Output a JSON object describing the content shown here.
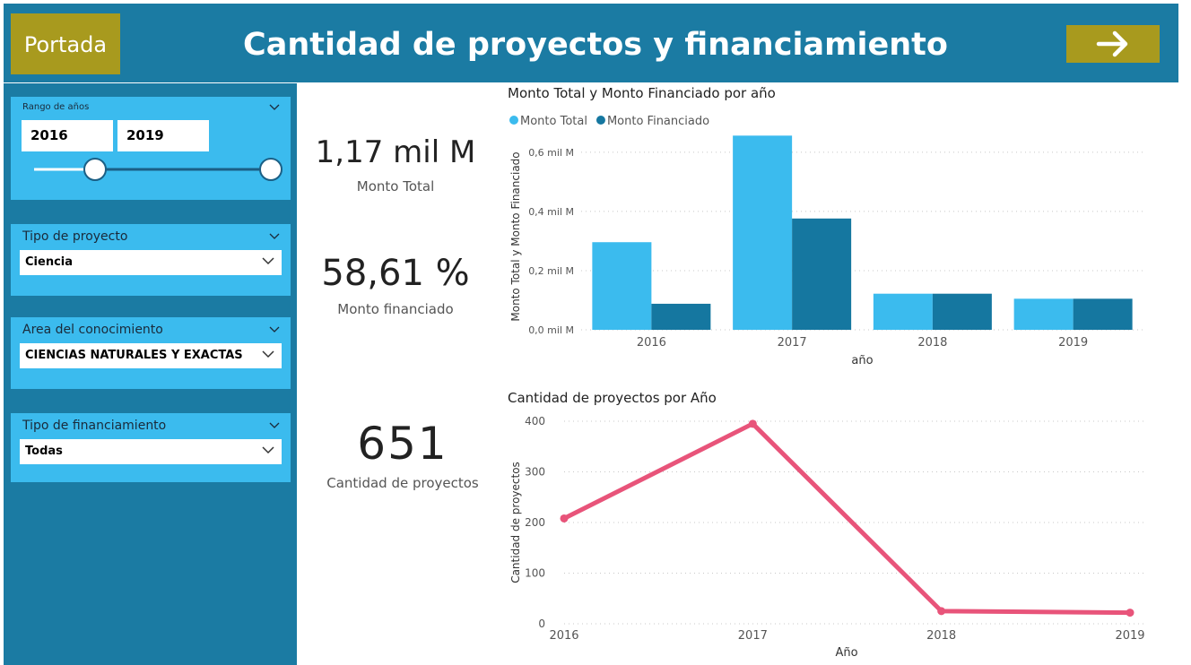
{
  "header": {
    "portada_label": "Portada",
    "title": "Cantidad de proyectos y financiamiento",
    "next_icon": "arrow-right-icon"
  },
  "filters": {
    "year_range": {
      "title": "Rango de años",
      "from": "2016",
      "to": "2019"
    },
    "tipo_proyecto": {
      "title": "Tipo de proyecto",
      "value": "Ciencia"
    },
    "area_conocimiento": {
      "title": "Area del conocimiento",
      "value": "CIENCIAS NATURALES Y EXACTAS"
    },
    "tipo_financiamiento": {
      "title": "Tipo de financiamiento",
      "value": "Todas"
    }
  },
  "kpis": {
    "monto_total": {
      "value": "1,17 mil M",
      "label": "Monto Total"
    },
    "monto_financiado": {
      "value": "58,61 %",
      "label": "Monto financiado"
    },
    "cantidad_proyectos": {
      "value": "651",
      "label": "Cantidad de proyectos"
    }
  },
  "colors": {
    "header_bg": "#1b7ba3",
    "button_bg": "#a89a1e",
    "slicer_bg": "#3bbbee",
    "monto_total": "#3bbbee",
    "monto_financiado": "#1577a0",
    "line": "#e8547a"
  },
  "chart_data": [
    {
      "type": "bar",
      "title": "Monto Total y Monto Financiado por año",
      "xlabel": "año",
      "ylabel": "Monto Total y Monto Financiado",
      "categories": [
        "2016",
        "2017",
        "2018",
        "2019"
      ],
      "series": [
        {
          "name": "Monto Total",
          "values": [
            0.296,
            0.656,
            0.122,
            0.105
          ]
        },
        {
          "name": "Monto Financiado",
          "values": [
            0.088,
            0.376,
            0.122,
            0.105
          ]
        }
      ],
      "ylim": [
        0,
        0.66
      ],
      "yticks": [
        {
          "v": 0,
          "label": "0,0 mil M"
        },
        {
          "v": 0.2,
          "label": "0,2 mil M"
        },
        {
          "v": 0.4,
          "label": "0,4 mil M"
        },
        {
          "v": 0.6,
          "label": "0,6 mil M"
        }
      ],
      "legend": "top-left",
      "grid": true
    },
    {
      "type": "line",
      "title": "Cantidad de proyectos por Año",
      "xlabel": "Año",
      "ylabel": "Cantidad de proyectos",
      "x": [
        "2016",
        "2017",
        "2018",
        "2019"
      ],
      "series": [
        {
          "values": [
            208,
            395,
            25,
            22
          ]
        }
      ],
      "ylim": [
        0,
        400
      ],
      "yticks": [
        {
          "v": 0,
          "label": "0"
        },
        {
          "v": 100,
          "label": "100"
        },
        {
          "v": 200,
          "label": "200"
        },
        {
          "v": 300,
          "label": "300"
        },
        {
          "v": 400,
          "label": "400"
        }
      ],
      "grid": true
    }
  ]
}
